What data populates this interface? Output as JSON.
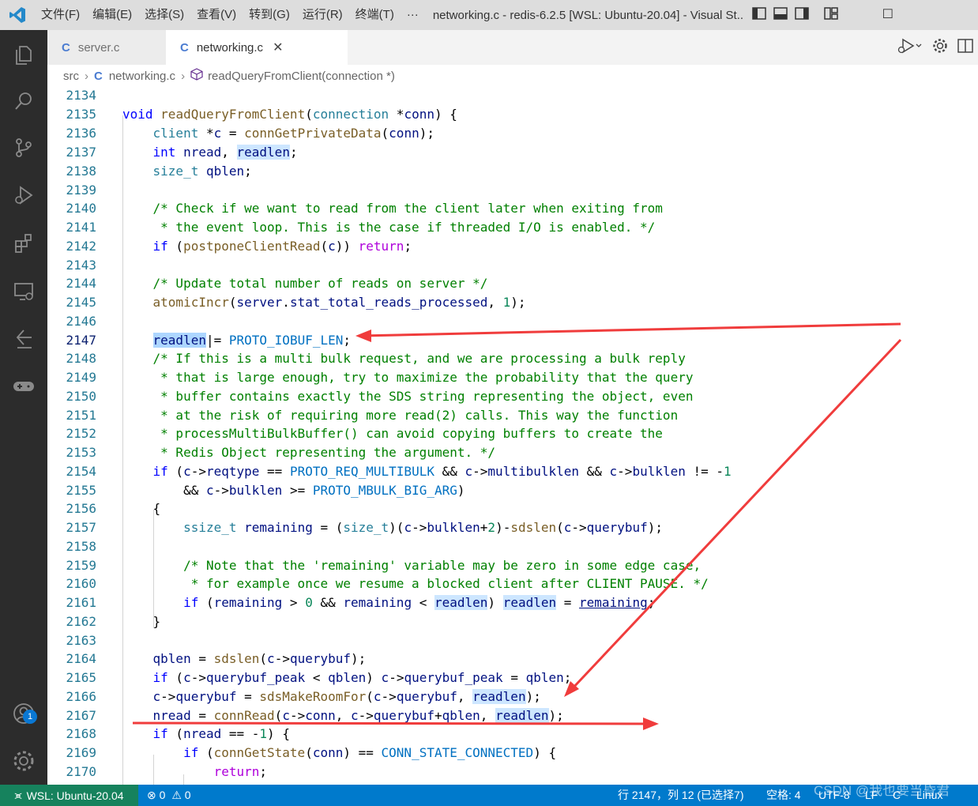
{
  "titlebar": {
    "menu": [
      "文件(F)",
      "编辑(E)",
      "选择(S)",
      "查看(V)",
      "转到(G)",
      "运行(R)",
      "终端(T)",
      "···"
    ],
    "title": "networking.c - redis-6.2.5 [WSL: Ubuntu-20.04] - Visual St...",
    "restore": "☐"
  },
  "activitybar": {
    "icons": [
      "explorer-icon",
      "search-icon",
      "source-control-icon",
      "run-debug-icon",
      "extensions-icon",
      "remote-explorer-icon",
      "timeline-icon",
      "gamepad-icon",
      "account-icon",
      "settings-gear-icon"
    ],
    "account_badge": "1"
  },
  "tabs": [
    {
      "icon": "C",
      "label": "server.c"
    },
    {
      "icon": "C",
      "label": "networking.c",
      "close": "✕"
    }
  ],
  "breadcrumb": {
    "folder": "src",
    "file_icon": "C",
    "file": "networking.c",
    "symbol": "readQueryFromClient(connection *)"
  },
  "editor": {
    "line_numbers": [
      "2134",
      "2135",
      "2136",
      "2137",
      "2138",
      "2139",
      "2140",
      "2141",
      "2142",
      "2143",
      "2144",
      "2145",
      "2146",
      "2147",
      "2148",
      "2149",
      "2150",
      "2151",
      "2152",
      "2153",
      "2154",
      "2155",
      "2156",
      "2157",
      "2158",
      "2159",
      "2160",
      "2161",
      "2162",
      "2163",
      "2164",
      "2165",
      "2166",
      "2167",
      "2168",
      "2169",
      "2170"
    ],
    "current_line": "2147"
  },
  "statusbar": {
    "remote": "WSL: Ubuntu-20.04",
    "errors": "0",
    "warnings": "0",
    "cursor": "行 2147，列 12 (已选择7)",
    "spaces": "空格: 4",
    "encoding": "UTF-8",
    "eol": "LF",
    "language": "C",
    "platform": "Linux",
    "watermark": "CSDN @我也要当昏君"
  },
  "colors": {
    "arrow": "#f03c3c",
    "statusbar": "#007acc",
    "remote": "#16825d",
    "activitybar": "#2c2c2c"
  }
}
